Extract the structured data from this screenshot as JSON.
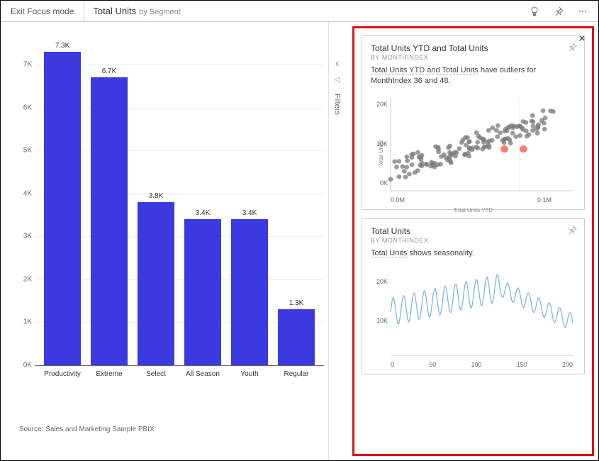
{
  "header": {
    "exit_label": "Exit Focus mode",
    "title": "Total Units",
    "subtitle": "by Segment"
  },
  "filters": {
    "label": "Filters"
  },
  "source": "Source: Sales and Marketing Sample PBIX",
  "chart_data": {
    "type": "bar",
    "categories": [
      "Productivity",
      "Extreme",
      "Select",
      "All Season",
      "Youth",
      "Regular"
    ],
    "values": [
      7300,
      6700,
      3800,
      3400,
      3400,
      1300
    ],
    "value_labels": [
      "7.3K",
      "6.7K",
      "3.8K",
      "3.4K",
      "3.4K",
      "1.3K"
    ],
    "ylim": [
      0,
      7500
    ],
    "y_ticks": [
      0,
      1000,
      2000,
      3000,
      4000,
      5000,
      6000,
      7000
    ],
    "y_tick_labels": [
      "0K",
      "1K",
      "2K",
      "3K",
      "4K",
      "5K",
      "6K",
      "7K"
    ]
  },
  "insights": {
    "card1": {
      "title": "Total Units YTD and Total Units",
      "subtitle": "BY MONTHINDEX",
      "desc_prefix": "Total Units YTD and Total Units",
      "desc_rest": " have outliers for MonthIndex 36 and 48.",
      "y_ticks": [
        "20K",
        "10K",
        "0K"
      ],
      "x_ticks": [
        "0.0M",
        "0.1M"
      ],
      "y_label": "Total Units",
      "x_label": "Total Units YTD"
    },
    "card2": {
      "title": "Total Units",
      "subtitle": "BY MONTHINDEX",
      "desc_prefix": "Total Units",
      "desc_rest": " shows seasonality.",
      "y_ticks": [
        "20K",
        "10K"
      ],
      "x_ticks": [
        "0",
        "50",
        "100",
        "150",
        "200"
      ]
    }
  }
}
